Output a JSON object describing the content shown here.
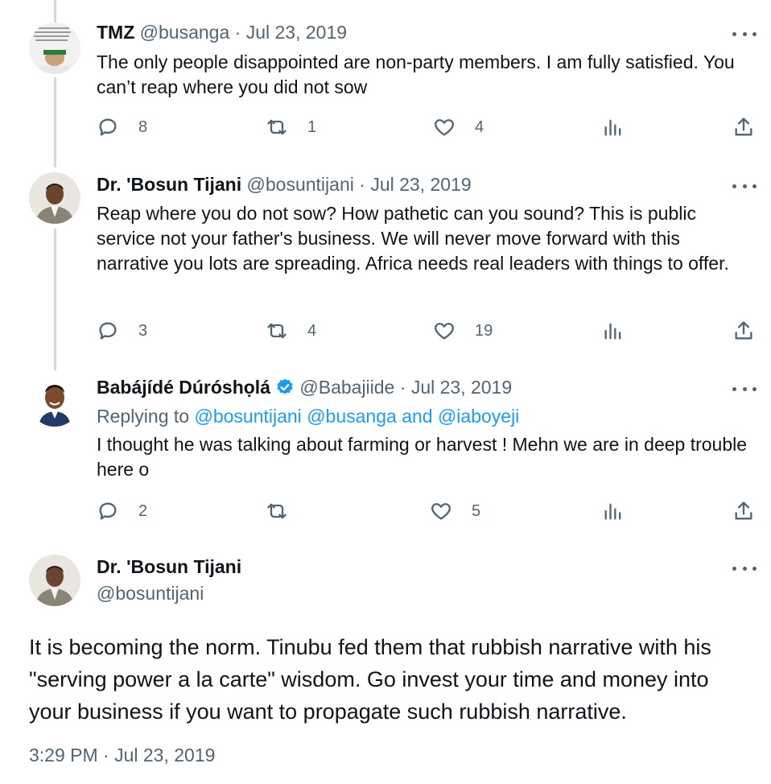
{
  "tweets": [
    {
      "name": "TMZ",
      "handle": "@busanga",
      "sep": "·",
      "date": "Jul 23, 2019",
      "text": "The only people disappointed are non-party members. I am fully satisfied. You can’t reap where you did not sow",
      "replies": "8",
      "retweets": "1",
      "likes": "4",
      "avatar_caption": "children of the po... failed to train wil never let your children have peace -Obafemi Awolowo"
    },
    {
      "name": "Dr. 'Bosun Tijani",
      "handle": "@bosuntijani",
      "sep": "·",
      "date": "Jul 23, 2019",
      "text": "Reap where you do not sow? How pathetic can you sound? This is public service not your father's business. We will never move forward with this narrative you lots are spreading. Africa needs real leaders with things to offer.",
      "replies": "3",
      "retweets": "4",
      "likes": "19"
    },
    {
      "name": "Babájídé Dúróshọlá",
      "handle": "@Babajiide",
      "sep": "·",
      "date": "Jul 23, 2019",
      "replying_prefix": "Replying to",
      "mention1": "@bosuntijani",
      "mention2": "@busanga",
      "and_word": "and",
      "mention3": "@iaboyeji",
      "text": "I thought he was talking about farming or harvest ! Mehn we are in deep trouble here o",
      "replies": "2",
      "retweets": "",
      "likes": "5"
    }
  ],
  "main_tweet": {
    "name": "Dr. 'Bosun Tijani",
    "handle": "@bosuntijani",
    "text": "It is becoming the norm. Tinubu fed them that rubbish narrative with his \"serving power a la carte\" wisdom. Go invest your time and money into your business if you want to propagate such rubbish narrative.",
    "timestamp": "3:29 PM · Jul 23, 2019"
  },
  "icons": [
    "reply-icon",
    "retweet-icon",
    "like-icon",
    "views-icon",
    "share-icon",
    "more-icon",
    "verified-badge-icon"
  ],
  "colors": {
    "text": "#0f1419",
    "secondary": "#536471",
    "link": "#1d9bf0",
    "thread_line": "#cfd9de"
  }
}
